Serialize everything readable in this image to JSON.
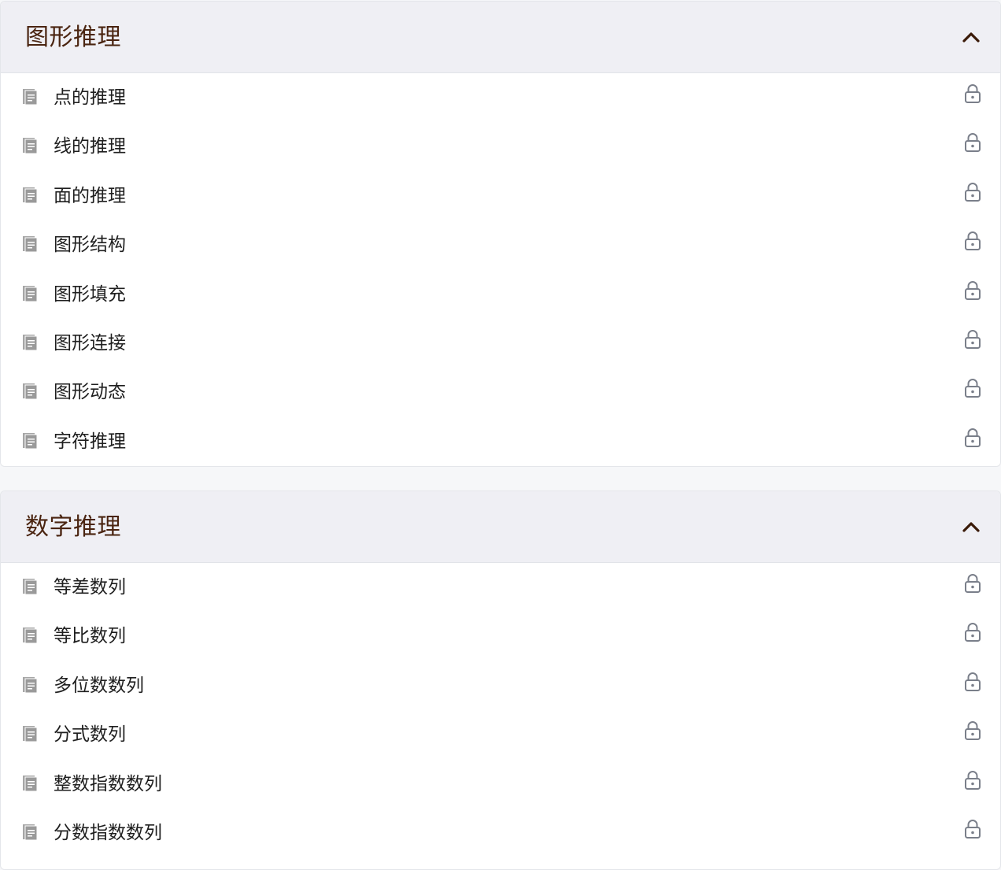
{
  "sections": [
    {
      "title": "图形推理",
      "collapse_icon": "chevron-up-icon",
      "items": [
        {
          "label": "点的推理",
          "icon": "document-icon",
          "status_icon": "lock-icon"
        },
        {
          "label": "线的推理",
          "icon": "document-icon",
          "status_icon": "lock-icon"
        },
        {
          "label": "面的推理",
          "icon": "document-icon",
          "status_icon": "lock-icon"
        },
        {
          "label": "图形结构",
          "icon": "document-icon",
          "status_icon": "lock-icon"
        },
        {
          "label": "图形填充",
          "icon": "document-icon",
          "status_icon": "lock-icon"
        },
        {
          "label": "图形连接",
          "icon": "document-icon",
          "status_icon": "lock-icon"
        },
        {
          "label": "图形动态",
          "icon": "document-icon",
          "status_icon": "lock-icon"
        },
        {
          "label": "字符推理",
          "icon": "document-icon",
          "status_icon": "lock-icon"
        }
      ]
    },
    {
      "title": "数字推理",
      "collapse_icon": "chevron-up-icon",
      "items": [
        {
          "label": "等差数列",
          "icon": "document-icon",
          "status_icon": "lock-icon"
        },
        {
          "label": "等比数列",
          "icon": "document-icon",
          "status_icon": "lock-icon"
        },
        {
          "label": "多位数数列",
          "icon": "document-icon",
          "status_icon": "lock-icon"
        },
        {
          "label": "分式数列",
          "icon": "document-icon",
          "status_icon": "lock-icon"
        },
        {
          "label": "整数指数数列",
          "icon": "document-icon",
          "status_icon": "lock-icon"
        },
        {
          "label": "分数指数数列",
          "icon": "document-icon",
          "status_icon": "lock-icon"
        }
      ]
    }
  ],
  "colors": {
    "header_bg": "#efeff4",
    "title_text": "#4a2410",
    "item_text": "#1f1f1f",
    "icon_gray": "#9a9a9a",
    "lock_gray": "#7a7f8a"
  }
}
